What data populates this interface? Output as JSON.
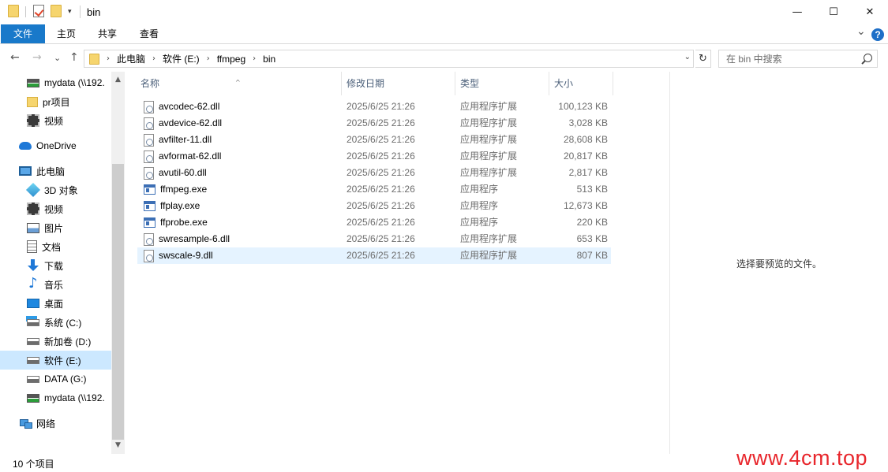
{
  "window": {
    "title": "bin",
    "minimize_glyph": "—",
    "maximize_glyph": "☐",
    "close_glyph": "✕"
  },
  "ribbon": {
    "tabs": [
      "文件",
      "主页",
      "共享",
      "查看"
    ],
    "expand_glyph": "⌄",
    "help_glyph": "?",
    "file_tab_color": "#1979ca"
  },
  "navigation": {
    "back_glyph": "←",
    "forward_glyph": "→",
    "recent_glyph": "⌄",
    "up_glyph": "↑",
    "breadcrumb": [
      "此电脑",
      "软件 (E:)",
      "ffmpeg",
      "bin"
    ],
    "breadcrumb_sep": "›",
    "refresh_glyph": "↻",
    "search_placeholder": "在 bin 中搜索"
  },
  "sidebar": {
    "items": [
      {
        "label": "mydata (\\\\192.",
        "icon": "network-drive-icon"
      },
      {
        "label": "pr项目",
        "icon": "folder-icon"
      },
      {
        "label": "视频",
        "icon": "videos-icon"
      },
      {
        "label": "OneDrive",
        "icon": "onedrive-icon"
      },
      {
        "label": "此电脑",
        "icon": "this-pc-icon"
      },
      {
        "label": "3D 对象",
        "icon": "3d-objects-icon"
      },
      {
        "label": "视频",
        "icon": "videos-icon"
      },
      {
        "label": "图片",
        "icon": "pictures-icon"
      },
      {
        "label": "文档",
        "icon": "documents-icon"
      },
      {
        "label": "下载",
        "icon": "downloads-icon"
      },
      {
        "label": "音乐",
        "icon": "music-icon"
      },
      {
        "label": "桌面",
        "icon": "desktop-icon"
      },
      {
        "label": "系统 (C:)",
        "icon": "system-drive-icon"
      },
      {
        "label": "新加卷 (D:)",
        "icon": "drive-icon"
      },
      {
        "label": "软件 (E:)",
        "icon": "drive-icon",
        "selected": true
      },
      {
        "label": "DATA (G:)",
        "icon": "drive-icon"
      },
      {
        "label": "mydata (\\\\192.",
        "icon": "network-drive-icon"
      },
      {
        "label": "网络",
        "icon": "network-icon"
      }
    ],
    "scroll_up_glyph": "▲",
    "scroll_down_glyph": "▼"
  },
  "file_list": {
    "columns": [
      "名称",
      "修改日期",
      "类型",
      "大小"
    ],
    "sort_glyph": "^",
    "rows": [
      {
        "name": "avcodec-62.dll",
        "date": "2025/6/25 21:26",
        "type": "应用程序扩展",
        "size": "100,123 KB",
        "kind": "dll"
      },
      {
        "name": "avdevice-62.dll",
        "date": "2025/6/25 21:26",
        "type": "应用程序扩展",
        "size": "3,028 KB",
        "kind": "dll"
      },
      {
        "name": "avfilter-11.dll",
        "date": "2025/6/25 21:26",
        "type": "应用程序扩展",
        "size": "28,608 KB",
        "kind": "dll"
      },
      {
        "name": "avformat-62.dll",
        "date": "2025/6/25 21:26",
        "type": "应用程序扩展",
        "size": "20,817 KB",
        "kind": "dll"
      },
      {
        "name": "avutil-60.dll",
        "date": "2025/6/25 21:26",
        "type": "应用程序扩展",
        "size": "2,817 KB",
        "kind": "dll"
      },
      {
        "name": "ffmpeg.exe",
        "date": "2025/6/25 21:26",
        "type": "应用程序",
        "size": "513 KB",
        "kind": "exe"
      },
      {
        "name": "ffplay.exe",
        "date": "2025/6/25 21:26",
        "type": "应用程序",
        "size": "12,673 KB",
        "kind": "exe"
      },
      {
        "name": "ffprobe.exe",
        "date": "2025/6/25 21:26",
        "type": "应用程序",
        "size": "220 KB",
        "kind": "exe"
      },
      {
        "name": "swresample-6.dll",
        "date": "2025/6/25 21:26",
        "type": "应用程序扩展",
        "size": "653 KB",
        "kind": "dll"
      },
      {
        "name": "swscale-9.dll",
        "date": "2025/6/25 21:26",
        "type": "应用程序扩展",
        "size": "807 KB",
        "kind": "dll",
        "hovered": true
      }
    ]
  },
  "preview": {
    "message": "选择要预览的文件。"
  },
  "status": {
    "item_count": "10 个项目"
  },
  "watermark": {
    "text": "www.4cm.top",
    "color": "#e8262c"
  }
}
